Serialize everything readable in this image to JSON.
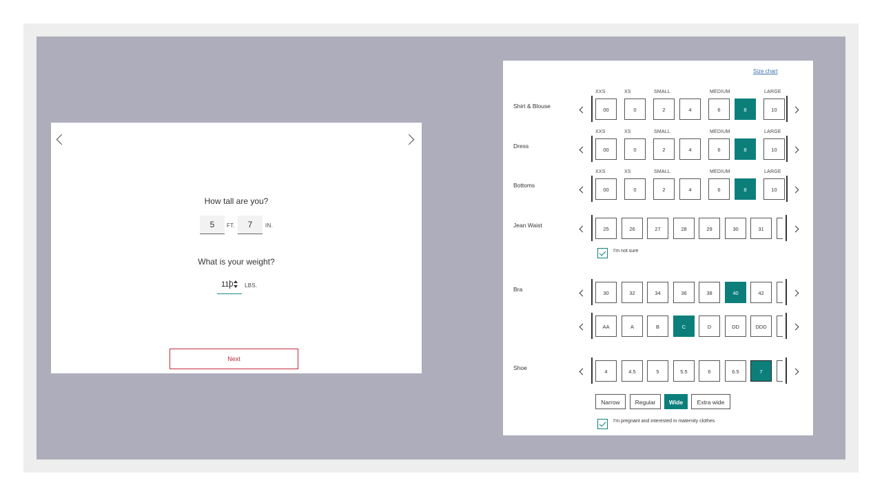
{
  "left_card": {
    "height_question": "How tall are you?",
    "height_feet": "5",
    "feet_unit": "FT.",
    "height_inches": "7",
    "inches_unit": "IN.",
    "weight_question": "What is your weight?",
    "weight_value": "110",
    "weight_unit": "LBS.",
    "next_label": "Next",
    "icons": {
      "prev": "chevron-left-icon",
      "next": "chevron-right-icon"
    }
  },
  "right_panel": {
    "size_chart_link": "Size chart",
    "scale_labels": {
      "xxs": "XXS",
      "xs": "XS",
      "small": "SMALL",
      "medium": "MEDIUM",
      "large": "LARGE"
    },
    "shirt": {
      "label": "Shirt & Blouse",
      "sizes": [
        "00",
        "0",
        "2",
        "4",
        "6",
        "8",
        "10"
      ],
      "selected": "8"
    },
    "dress": {
      "label": "Dress",
      "sizes": [
        "00",
        "0",
        "2",
        "4",
        "6",
        "8",
        "10"
      ],
      "selected": "8"
    },
    "bottoms": {
      "label": "Bottoms",
      "sizes": [
        "00",
        "0",
        "2",
        "4",
        "6",
        "8",
        "10"
      ],
      "selected": "8"
    },
    "jean": {
      "label": "Jean Waist",
      "sizes": [
        "25",
        "26",
        "27",
        "28",
        "29",
        "30",
        "31"
      ],
      "not_sure_label": "I'm not sure",
      "not_sure_checked": true
    },
    "bra": {
      "label": "Bra",
      "bands": [
        "30",
        "32",
        "34",
        "36",
        "38",
        "40",
        "42"
      ],
      "band_selected": "40",
      "cups": [
        "AA",
        "A",
        "B",
        "C",
        "D",
        "DD",
        "DDD"
      ],
      "cup_selected": "C"
    },
    "shoe": {
      "label": "Shoe",
      "sizes": [
        "4",
        "4.5",
        "5",
        "5.5",
        "6",
        "6.5",
        "7"
      ],
      "selected": "7",
      "widths": [
        "Narrow",
        "Regular",
        "Wide",
        "Extra wide"
      ],
      "width_selected": "Wide"
    },
    "maternity_label": "I'm pregnant and interested in maternity clothes",
    "maternity_checked": true,
    "colors": {
      "accent": "#0d7f7b",
      "next_border": "#c0283c",
      "stage": "#adadbb"
    }
  }
}
